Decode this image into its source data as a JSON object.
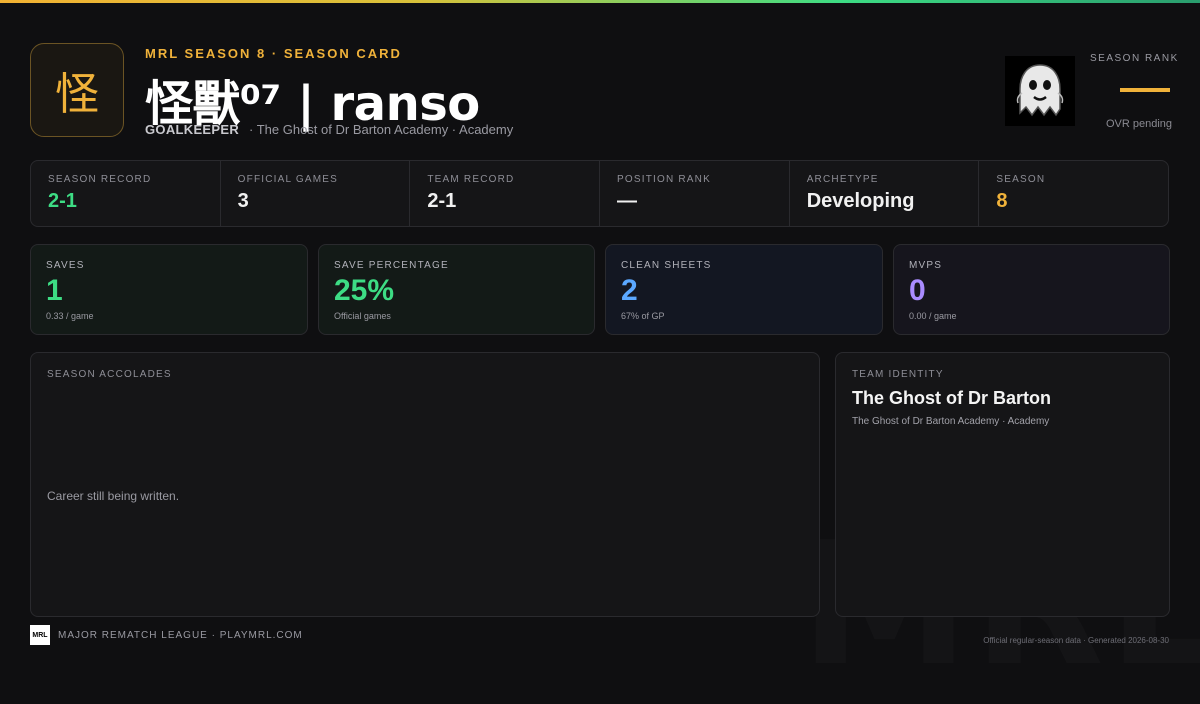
{
  "header": {
    "logo_glyph": "怪",
    "eyebrow": "MRL SEASON 8 · SEASON CARD",
    "player_name": "怪獸⁰⁷ | ranso",
    "position": "GOALKEEPER",
    "team_line": "· The Ghost of Dr Barton Academy · Academy"
  },
  "rank": {
    "label": "SEASON RANK",
    "value": "—",
    "note": "OVR pending",
    "image_icon": "ghost-avatar"
  },
  "record_strip": [
    {
      "label": "SEASON RECORD",
      "value": "2-1",
      "color": "#3ddc84"
    },
    {
      "label": "OFFICIAL GAMES",
      "value": "3",
      "color": "#f1f1f1"
    },
    {
      "label": "TEAM RECORD",
      "value": "2-1",
      "color": "#f1f1f1"
    },
    {
      "label": "POSITION RANK",
      "value": "—",
      "color": "#f1f1f1"
    },
    {
      "label": "ARCHETYPE",
      "value": "Developing",
      "color": "#f1f1f1"
    },
    {
      "label": "SEASON",
      "value": "8",
      "color": "#f0b23a"
    }
  ],
  "stats": [
    {
      "label": "SAVES",
      "value": "1",
      "sub": "0.33 / game",
      "color": "#3ddc84",
      "bg": "#131a17"
    },
    {
      "label": "SAVE PERCENTAGE",
      "value": "25%",
      "sub": "Official games",
      "color": "#3ddc84",
      "bg": "#131a17"
    },
    {
      "label": "CLEAN SHEETS",
      "value": "2",
      "sub": "67% of GP",
      "color": "#5ba8ff",
      "bg": "#131722"
    },
    {
      "label": "MVPS",
      "value": "0",
      "sub": "0.00 / game",
      "color": "#a98bff",
      "bg": "#16151d"
    }
  ],
  "accolades": {
    "label": "SEASON ACCOLADES",
    "empty_text": "Career still being written."
  },
  "team_identity": {
    "label": "TEAM IDENTITY",
    "name": "The Ghost of Dr Barton",
    "sub": "The Ghost of Dr Barton Academy · Academy"
  },
  "footer": {
    "logo_text": "MRL",
    "brand": "MAJOR REMATCH LEAGUE · PLAYMRL.COM",
    "note": "Official regular-season data · Generated 2026-08-30",
    "watermark": "MRL"
  }
}
